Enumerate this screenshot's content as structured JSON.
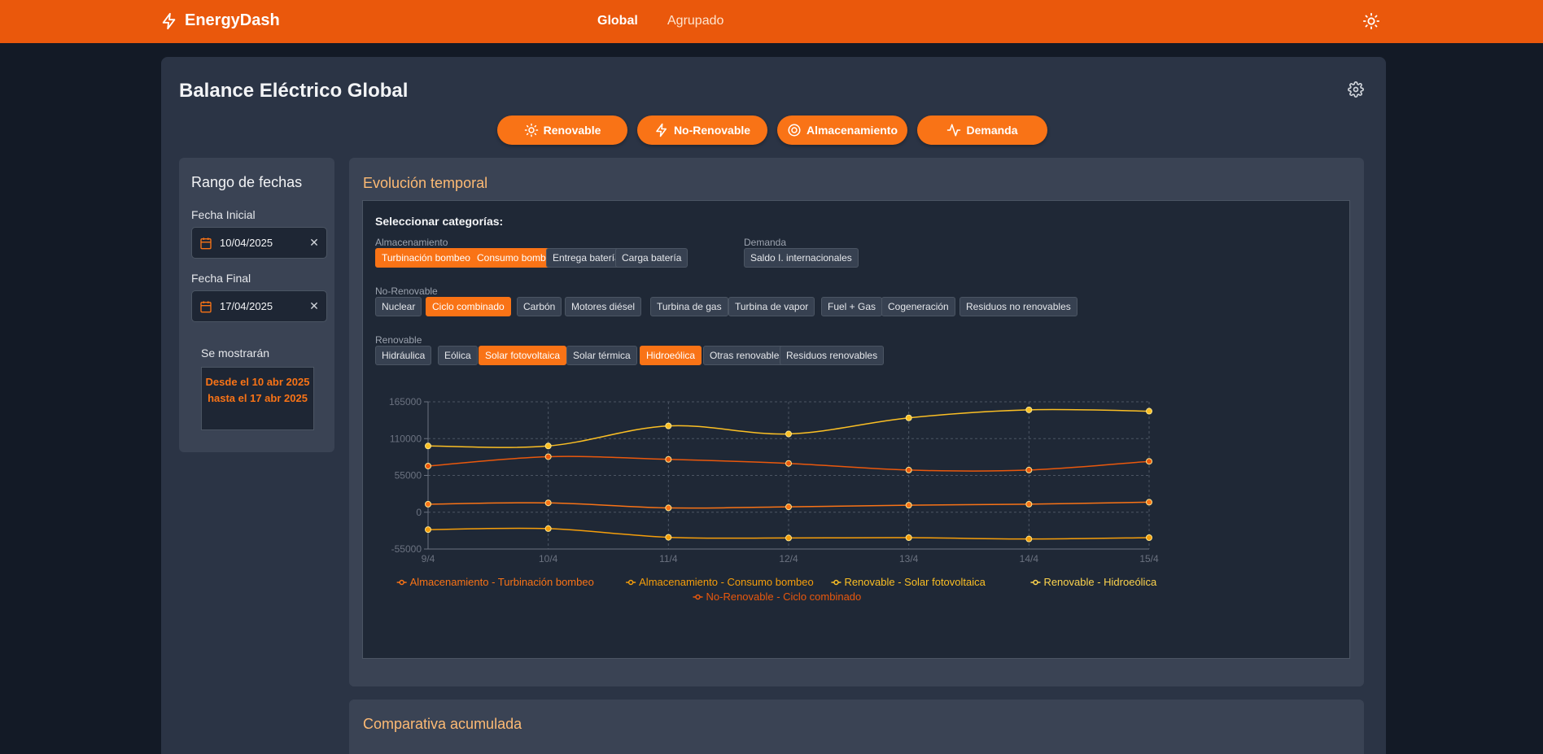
{
  "nav": {
    "brand": "EnergyDash",
    "links": [
      "Global",
      "Agrupado"
    ]
  },
  "page": {
    "title": "Balance Eléctrico Global"
  },
  "categories": [
    "Renovable",
    "No-Renovable",
    "Almacenamiento",
    "Demanda"
  ],
  "sidebar": {
    "title": "Rango de fechas",
    "start_label": "Fecha Inicial",
    "start_value": "10/04/2025",
    "end_label": "Fecha Final",
    "end_value": "17/04/2025",
    "show_label": "Se mostrarán",
    "show_text": "Desde el 10 abr 2025 hasta el 17 abr 2025"
  },
  "evolution": {
    "title": "Evolución temporal",
    "select_title": "Seleccionar categorías:",
    "groups": {
      "almacenamiento": {
        "label": "Almacenamiento",
        "chips": [
          "Turbinación bombeo",
          "Consumo bombeo",
          "Entrega batería",
          "Carga batería"
        ],
        "active": [
          true,
          true,
          false,
          false
        ]
      },
      "demanda": {
        "label": "Demanda",
        "chips": [
          "Saldo I. internacionales"
        ],
        "active": [
          false
        ]
      },
      "norenovable": {
        "label": "No-Renovable",
        "chips": [
          "Nuclear",
          "Ciclo combinado",
          "Carbón",
          "Motores diésel",
          "Turbina de gas",
          "Turbina de vapor",
          "Fuel + Gas",
          "Cogeneración",
          "Residuos no renovables"
        ],
        "active": [
          false,
          true,
          false,
          false,
          false,
          false,
          false,
          false,
          false
        ]
      },
      "renovable": {
        "label": "Renovable",
        "chips": [
          "Hidráulica",
          "Eólica",
          "Solar fotovoltaica",
          "Solar térmica",
          "Hidroeólica",
          "Otras renovables",
          "Residuos renovables"
        ],
        "active": [
          false,
          false,
          true,
          false,
          true,
          false,
          false
        ]
      }
    }
  },
  "chart_data": {
    "type": "line",
    "x": [
      "9/4",
      "10/4",
      "11/4",
      "12/4",
      "13/4",
      "14/4",
      "15/4"
    ],
    "ylim": [
      -55000,
      165000
    ],
    "yticks": [
      165000,
      110000,
      55000,
      0,
      -55000
    ],
    "grid": true,
    "legend_position": "bottom",
    "series": [
      {
        "name": "Almacenamiento - Turbinación bombeo",
        "color": "#f97316",
        "values": [
          12000,
          14000,
          6500,
          8000,
          10500,
          12000,
          15000
        ]
      },
      {
        "name": "Almacenamiento - Consumo bombeo",
        "color": "#f59e0b",
        "values": [
          -26000,
          -24500,
          -37500,
          -38500,
          -38000,
          -40000,
          -38000
        ]
      },
      {
        "name": "Renovable - Solar fotovoltaica",
        "color": "#fbbf24",
        "values": [
          99000,
          99000,
          129000,
          117000,
          141000,
          153000,
          151000
        ]
      },
      {
        "name": "Renovable - Hidroeólica",
        "color": "#fcd34d",
        "values": []
      },
      {
        "name": "No-Renovable - Ciclo combinado",
        "color": "#ea580c",
        "values": [
          69000,
          83000,
          79000,
          73000,
          63000,
          63000,
          76000
        ]
      }
    ]
  },
  "comparison": {
    "title": "Comparativa acumulada"
  }
}
